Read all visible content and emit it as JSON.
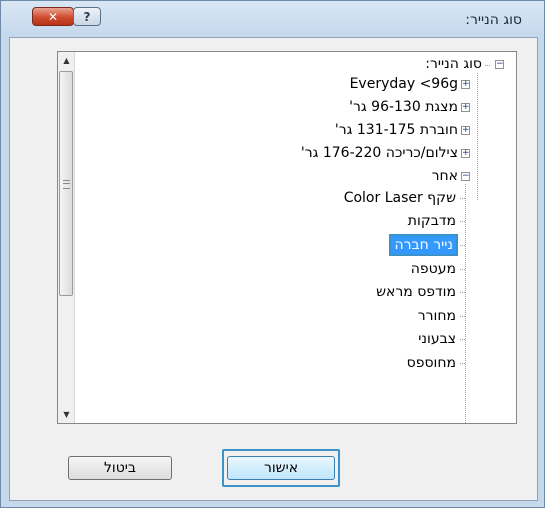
{
  "window": {
    "title": "סוג הנייר:",
    "close_glyph": "✕",
    "help_glyph": "?"
  },
  "tree": {
    "root": "סוג הנייר:",
    "children": [
      "Everyday <96g",
      "מצגת 96-130 גר'",
      "חוברת 131-175 גר'",
      "צילום/כריכה 176-220 גר'",
      "אחר"
    ],
    "other_children": [
      "שקף Color Laser",
      "מדבקות",
      "נייר חברה",
      "מעטפה",
      "מודפס מראש",
      "מחורר",
      "צבעוני",
      "מחוספס"
    ],
    "selected": "נייר חברה"
  },
  "buttons": {
    "cancel": "ביטול",
    "ok": "אישור"
  }
}
